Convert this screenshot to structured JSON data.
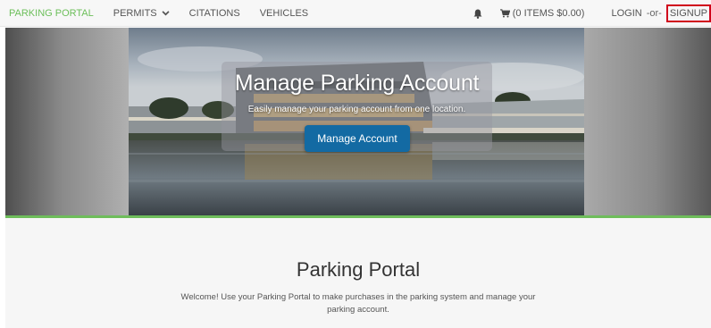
{
  "nav": {
    "brand": "PARKING PORTAL",
    "items": [
      {
        "label": "PERMITS",
        "has_dropdown": true
      },
      {
        "label": "CITATIONS",
        "has_dropdown": false
      },
      {
        "label": "VEHICLES",
        "has_dropdown": false
      }
    ],
    "cart_label": "(0 ITEMS $0.00)",
    "login_label": "LOGIN",
    "or_label": "-or-",
    "signup_label": "SIGNUP",
    "icons": [
      "bell-icon",
      "cart-icon",
      "chevron-down-icon"
    ],
    "brand_color": "#6cbf5a"
  },
  "hero": {
    "title": "Manage Parking Account",
    "subtitle": "Easily manage your parking account from one location.",
    "button_label": "Manage Account",
    "button_color": "#136aa3",
    "accent_bar_color": "#6ebd5b"
  },
  "main": {
    "title": "Parking Portal",
    "welcome_text": "Welcome! Use your Parking Portal to make purchases in the parking system and manage your parking account."
  }
}
